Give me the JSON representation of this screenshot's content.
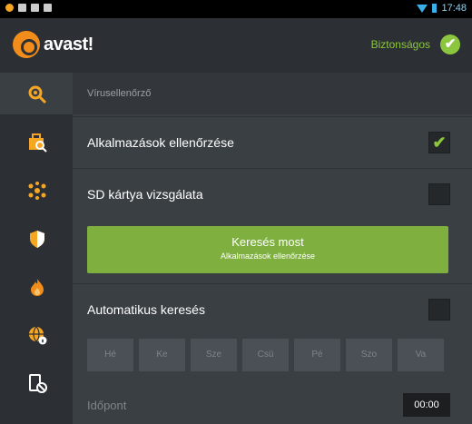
{
  "statusbar": {
    "time": "17:48"
  },
  "header": {
    "logo_text": "avast!",
    "status": "Biztonságos",
    "status_icon": "check-icon"
  },
  "sidebar": {
    "items": [
      {
        "icon": "virus-scan-icon",
        "color": "#f5a623"
      },
      {
        "icon": "app-lock-icon",
        "color": "#f5a623"
      },
      {
        "icon": "network-icon",
        "color": "#f5a623"
      },
      {
        "icon": "shield-icon",
        "color": "#f5a623"
      },
      {
        "icon": "firewall-flame-icon",
        "color": "#f5a623"
      },
      {
        "icon": "web-shield-icon",
        "color": "#f5a623"
      },
      {
        "icon": "device-block-icon",
        "color": "#ffffff"
      }
    ]
  },
  "main": {
    "section_title": "Vírusellenőrző",
    "apps_check": {
      "label": "Alkalmazások ellenőrzése",
      "checked": true
    },
    "sd_card": {
      "label": "SD kártya vizsgálata",
      "checked": false
    },
    "scan_button": {
      "title": "Keresés most",
      "subtitle": "Alkalmazások ellenőrzése"
    },
    "auto_scan": {
      "label": "Automatikus keresés",
      "checked": false
    },
    "days": [
      "Hé",
      "Ke",
      "Sze",
      "Csü",
      "Pé",
      "Szo",
      "Va"
    ],
    "time": {
      "label": "Időpont",
      "value": "00:00"
    }
  },
  "colors": {
    "accent": "#8cc63f",
    "brand_orange": "#f28c1a",
    "panel": "#3a3f44",
    "sidebar": "#2c3034"
  }
}
